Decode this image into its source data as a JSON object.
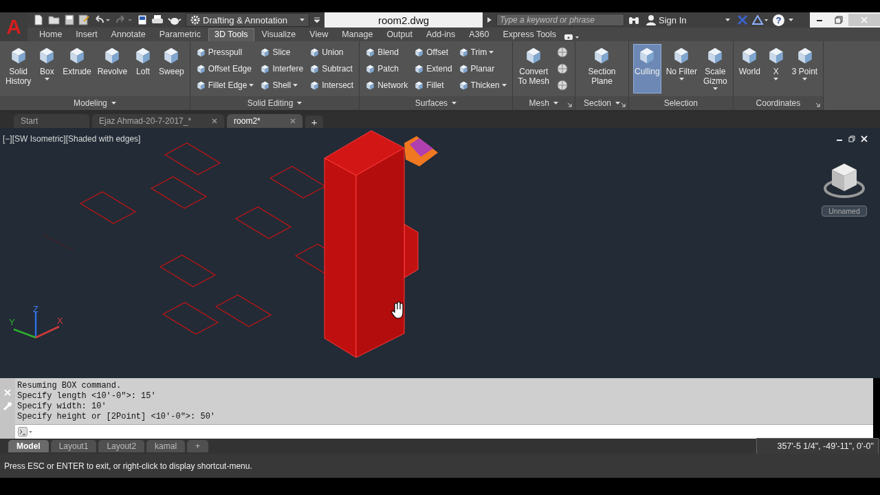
{
  "title_bar": {
    "app_button": "A",
    "workspace": "Drafting & Annotation",
    "title": "room2.dwg",
    "search": {
      "placeholder": "Type a keyword or phrase"
    },
    "sign_in": "Sign In",
    "help": "?"
  },
  "ribbon_tabs": [
    {
      "label": "Home",
      "selected": false
    },
    {
      "label": "Insert",
      "selected": false
    },
    {
      "label": "Annotate",
      "selected": false
    },
    {
      "label": "Parametric",
      "selected": false
    },
    {
      "label": "3D Tools",
      "selected": true
    },
    {
      "label": "Visualize",
      "selected": false
    },
    {
      "label": "View",
      "selected": false
    },
    {
      "label": "Manage",
      "selected": false
    },
    {
      "label": "Output",
      "selected": false
    },
    {
      "label": "Add-ins",
      "selected": false
    },
    {
      "label": "A360",
      "selected": false
    },
    {
      "label": "Express Tools",
      "selected": false
    }
  ],
  "ribbon_panels": [
    {
      "title": "Modeling",
      "menu": true,
      "launcher": false,
      "tools": [
        {
          "kind": "large",
          "label": "Solid\nHistory"
        },
        {
          "kind": "large",
          "label": "Box",
          "dropdown": true
        },
        {
          "kind": "large",
          "label": "Extrude"
        },
        {
          "kind": "large",
          "label": "Revolve"
        },
        {
          "kind": "large",
          "label": "Loft"
        },
        {
          "kind": "large",
          "label": "Sweep"
        }
      ]
    },
    {
      "title": "Solid Editing",
      "menu": true,
      "launcher": false,
      "tools": [
        {
          "kind": "small",
          "label": "Presspull"
        },
        {
          "kind": "small",
          "label": "Offset Edge"
        },
        {
          "kind": "small",
          "label": "Fillet Edge",
          "dropdown": true
        },
        {
          "kind": "small",
          "label": "Slice"
        },
        {
          "kind": "small",
          "label": "Interfere"
        },
        {
          "kind": "small",
          "label": "Shell",
          "dropdown": true
        },
        {
          "kind": "small",
          "label": "Union"
        },
        {
          "kind": "small",
          "label": "Subtract"
        },
        {
          "kind": "small",
          "label": "Intersect"
        }
      ]
    },
    {
      "title": "Surfaces",
      "menu": true,
      "launcher": false,
      "tools": [
        {
          "kind": "small",
          "label": "Blend"
        },
        {
          "kind": "small",
          "label": "Patch"
        },
        {
          "kind": "small",
          "label": "Network"
        },
        {
          "kind": "small",
          "label": "Offset"
        },
        {
          "kind": "small",
          "label": "Extend"
        },
        {
          "kind": "small",
          "label": "Fillet"
        },
        {
          "kind": "small",
          "label": "Trim",
          "dropdown": true
        },
        {
          "kind": "small",
          "label": "Planar"
        },
        {
          "kind": "small",
          "label": "Thicken",
          "dropdown": true
        }
      ]
    },
    {
      "title": "Mesh",
      "menu": true,
      "launcher": true,
      "tools": [
        {
          "kind": "large",
          "label": "Convert\nTo Mesh"
        },
        {
          "kind": "icon"
        },
        {
          "kind": "icon"
        },
        {
          "kind": "icon"
        }
      ]
    },
    {
      "title": "Section",
      "menu": true,
      "launcher": true,
      "tools": [
        {
          "kind": "large",
          "label": "Section\nPlane"
        }
      ]
    },
    {
      "title": "Selection",
      "menu": false,
      "launcher": false,
      "tools": [
        {
          "kind": "large",
          "label": "Culling",
          "on": true
        },
        {
          "kind": "large",
          "label": "No Filter",
          "dropdown": true
        },
        {
          "kind": "large",
          "label": "Scale\nGizmo",
          "dropdown": true
        }
      ]
    },
    {
      "title": "Coordinates",
      "menu": false,
      "launcher": true,
      "tools": [
        {
          "kind": "large",
          "label": "World"
        },
        {
          "kind": "large",
          "label": "X",
          "dropdown": true
        },
        {
          "kind": "large",
          "label": "3 Point",
          "dropdown": true
        }
      ]
    }
  ],
  "file_tabs": [
    {
      "label": "Start",
      "selected": false,
      "closable": false
    },
    {
      "label": "Ejaz Ahmad-20-7-2017_*",
      "selected": false,
      "closable": true
    },
    {
      "label": "room2*",
      "selected": true,
      "closable": true
    }
  ],
  "file_tab_add": "+",
  "viewport": {
    "label": "[−][SW Isometric][Shaded with edges]",
    "named_view": "Unnamed",
    "ucs_axes": {
      "x": "X",
      "y": "Y",
      "z": "Z"
    }
  },
  "command_line": {
    "history": [
      "Resuming BOX command.",
      "Specify length <10'-0\">: 15'",
      "Specify width: 10'",
      "Specify height or [2Point] <10'-0\">: 50'"
    ]
  },
  "layout_tabs": [
    {
      "label": "Model",
      "selected": true
    },
    {
      "label": "Layout1",
      "selected": false
    },
    {
      "label": "Layout2",
      "selected": false
    },
    {
      "label": "kamal",
      "selected": false
    }
  ],
  "layout_tab_add": "+",
  "coordinates": "357'-5 1/4\", -49'-11\", 0'-0\"",
  "status_message": "Press ESC or ENTER to exit, or right-click to display shortcut-menu."
}
